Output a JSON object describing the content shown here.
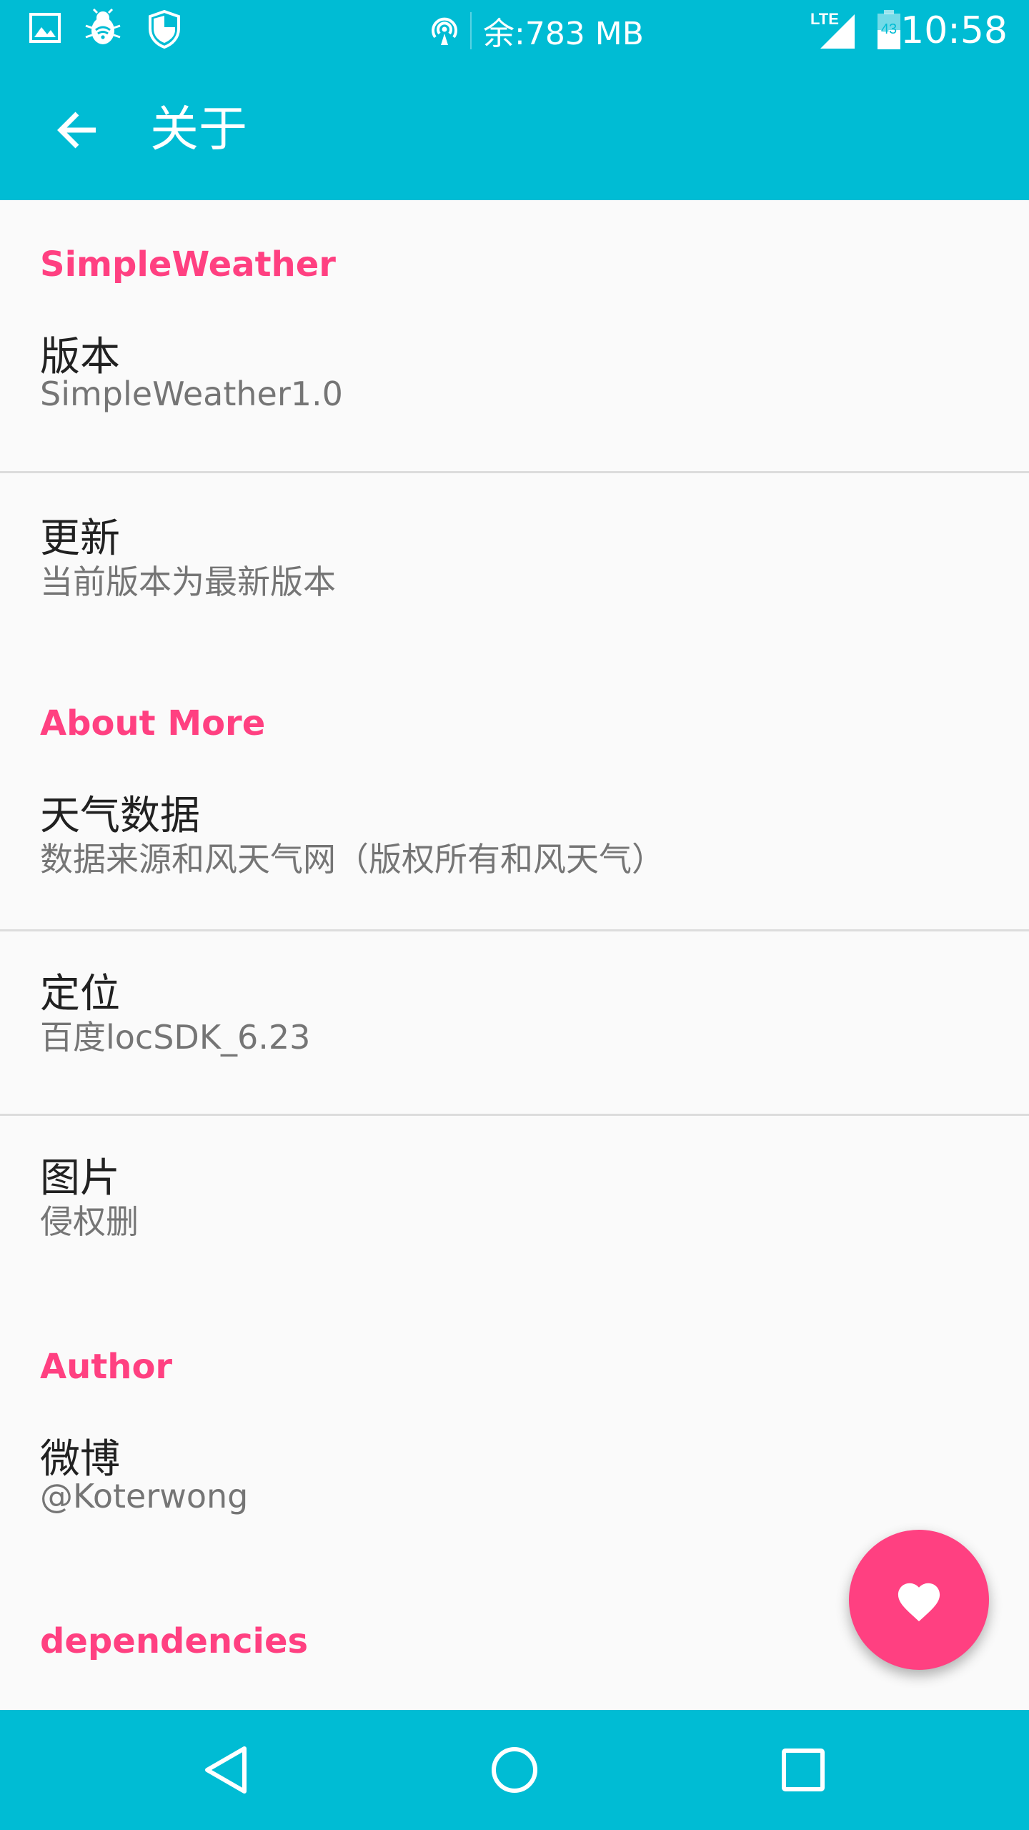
{
  "status_bar": {
    "memory_text": "余:783 MB",
    "time": "10:58",
    "network": "LTE",
    "battery_level": "43",
    "icons": [
      "image-icon",
      "bug-icon",
      "shield-icon",
      "hotspot-icon",
      "signal-icon",
      "battery-icon"
    ]
  },
  "app_bar": {
    "back_icon": "arrow-back-icon",
    "title": "关于"
  },
  "sections": [
    {
      "header": "SimpleWeather",
      "items": [
        {
          "title": "版本",
          "summary": "SimpleWeather1.0"
        },
        {
          "title": "更新",
          "summary": "当前版本为最新版本"
        }
      ]
    },
    {
      "header": "About More",
      "items": [
        {
          "title": "天气数据",
          "summary": "数据来源和风天气网（版权所有和风天气）"
        },
        {
          "title": "定位",
          "summary": "百度locSDK_6.23"
        },
        {
          "title": "图片",
          "summary": "侵权删"
        }
      ]
    },
    {
      "header": "Author",
      "items": [
        {
          "title": "微博",
          "summary": "@Koterwong"
        }
      ]
    },
    {
      "header": "dependencies",
      "items": []
    }
  ],
  "fab": {
    "icon": "heart-icon"
  },
  "nav_bar": {
    "icons": [
      "back-triangle-icon",
      "home-circle-icon",
      "recents-square-icon"
    ]
  },
  "colors": {
    "primary": "#00bcd4",
    "accent": "#ff4081",
    "background": "#fafafa",
    "title_text": "#212121",
    "summary_text": "#757575"
  }
}
